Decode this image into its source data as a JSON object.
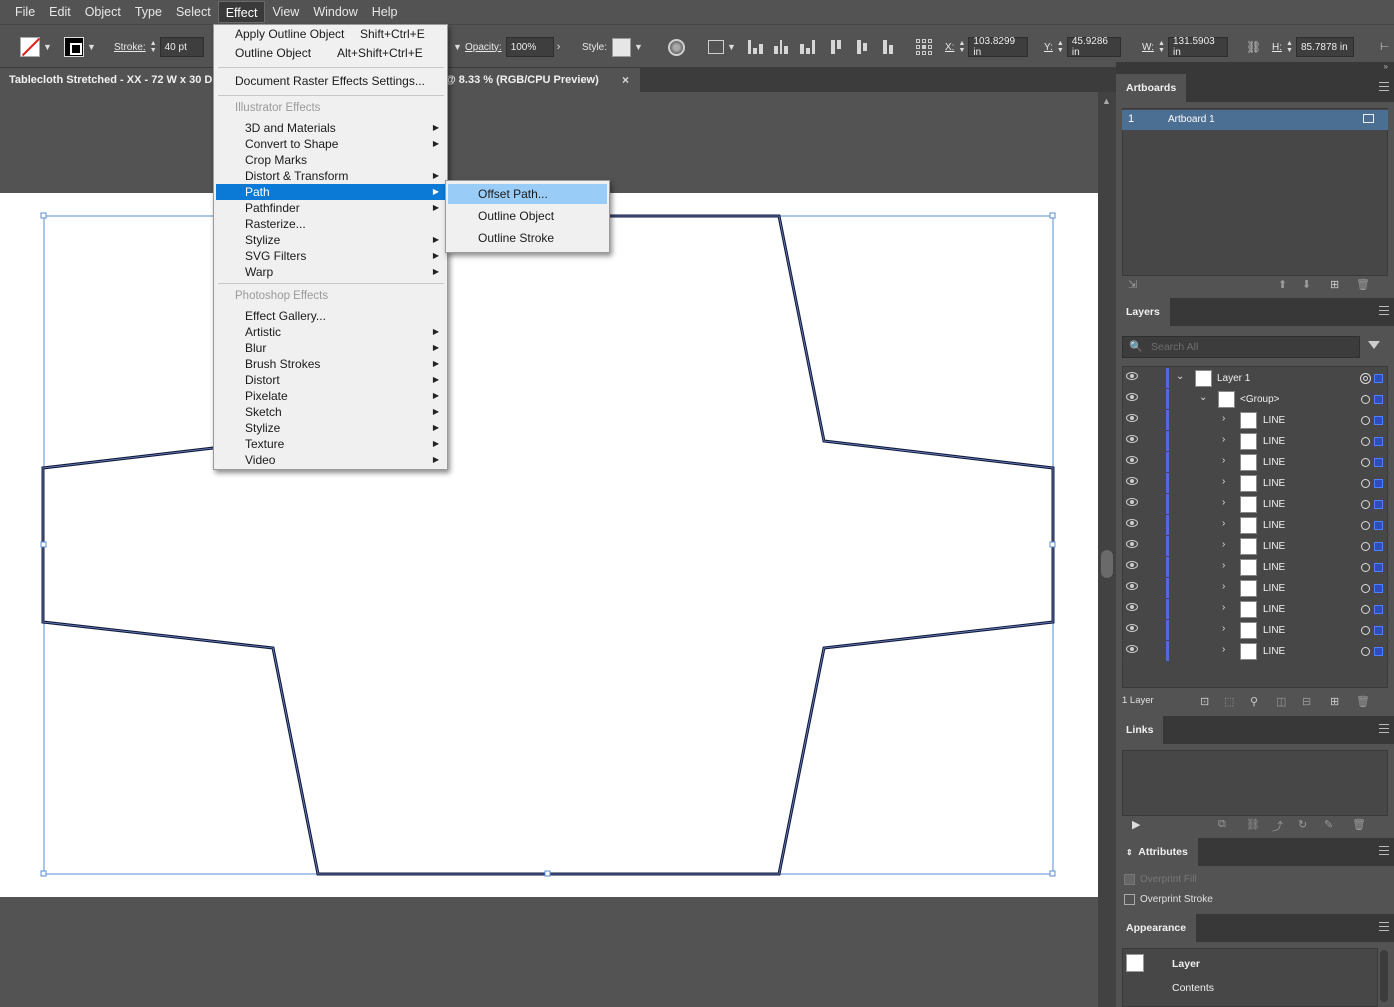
{
  "menubar": {
    "items": [
      "File",
      "Edit",
      "Object",
      "Type",
      "Select",
      "Effect",
      "View",
      "Window",
      "Help"
    ],
    "active": "Effect"
  },
  "controlbar": {
    "stroke_label": "Stroke:",
    "stroke_weight": "40 pt",
    "opacity_label": "Opacity:",
    "opacity_value": "100%",
    "style_label": "Style:",
    "x_label": "X:",
    "x_value": "103.8299 in",
    "y_label": "Y:",
    "y_value": "45.9286 in",
    "w_label": "W:",
    "w_value": "131.5903 in",
    "h_label": "H:",
    "h_value": "85.7878 in"
  },
  "document": {
    "title": "Tablecloth Stretched - XX - 72 W x 30 D",
    "zoom_info": "@ 8.33 % (RGB/CPU Preview)",
    "close_glyph": "×"
  },
  "effect_menu": {
    "apply_outline": {
      "label": "Apply Outline Object",
      "shortcut": "Shift+Ctrl+E"
    },
    "outline_object": {
      "label": "Outline Object",
      "shortcut": "Alt+Shift+Ctrl+E"
    },
    "raster_settings": "Document Raster Effects Settings...",
    "illustrator_header": "Illustrator Effects",
    "illustrator_items": [
      "3D and Materials",
      "Convert to Shape",
      "Crop Marks",
      "Distort & Transform",
      "Path",
      "Pathfinder",
      "Rasterize...",
      "Stylize",
      "SVG Filters",
      "Warp"
    ],
    "photoshop_header": "Photoshop Effects",
    "photoshop_items": [
      "Effect Gallery...",
      "Artistic",
      "Blur",
      "Brush Strokes",
      "Distort",
      "Pixelate",
      "Sketch",
      "Stylize",
      "Texture",
      "Video"
    ],
    "selected": "Path"
  },
  "path_submenu": {
    "items": [
      "Offset Path...",
      "Outline Object",
      "Outline Stroke"
    ],
    "highlighted": "Offset Path..."
  },
  "panels": {
    "artboards": {
      "tab": "Artboards",
      "rows": [
        {
          "num": "1",
          "name": "Artboard 1"
        }
      ]
    },
    "layers": {
      "tab": "Layers",
      "search_placeholder": "Search All",
      "top_layer": "Layer 1",
      "group": "<Group>",
      "line_items": [
        "LINE",
        "LINE",
        "LINE",
        "LINE",
        "LINE",
        "LINE",
        "LINE",
        "LINE",
        "LINE",
        "LINE",
        "LINE",
        "LINE"
      ],
      "count": "1 Layer"
    },
    "links": {
      "tab": "Links"
    },
    "attributes": {
      "tab": "Attributes",
      "overprint_fill": "Overprint Fill",
      "overprint_stroke": "Overprint Stroke"
    },
    "appearance": {
      "tab": "Appearance",
      "layer": "Layer",
      "contents": "Contents"
    }
  },
  "colors": {
    "selection_blue": "#4f6bd9",
    "menu_highlight": "#0b7ad6",
    "submenu_highlight": "#99ccf7"
  }
}
